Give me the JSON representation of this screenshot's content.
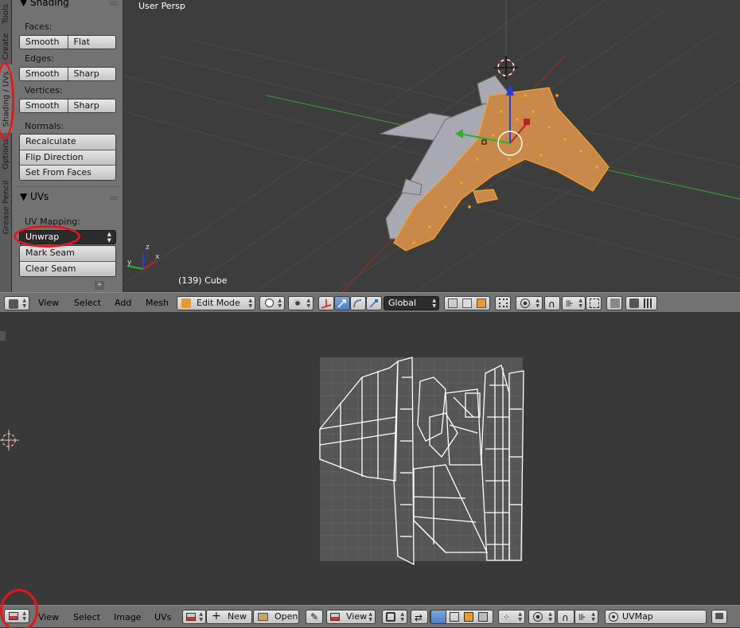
{
  "viewport3d": {
    "view_name": "User Persp",
    "object_info": "(139) Cube",
    "axis_labels": {
      "x": "x",
      "y": "y",
      "z": "z"
    }
  },
  "tabs": [
    "Tools",
    "Create",
    "Shading / UVs",
    "Options",
    "Grease Pencil"
  ],
  "shading_panel": {
    "title": "Shading",
    "faces_label": "Faces:",
    "faces_buttons": [
      "Smooth",
      "Flat"
    ],
    "edges_label": "Edges:",
    "edges_buttons": [
      "Smooth",
      "Sharp"
    ],
    "vertices_label": "Vertices:",
    "vertices_buttons": [
      "Smooth",
      "Sharp"
    ],
    "normals_label": "Normals:",
    "normals_buttons": [
      "Recalculate",
      "Flip Direction",
      "Set From Faces"
    ]
  },
  "uvs_panel": {
    "title": "UVs",
    "mapping_label": "UV Mapping:",
    "mapping_value": "Unwrap",
    "buttons": [
      "Mark Seam",
      "Clear Seam"
    ]
  },
  "header3d": {
    "menus": [
      "View",
      "Select",
      "Add",
      "Mesh"
    ],
    "mode": "Edit Mode",
    "orientation": "Global"
  },
  "header_uv": {
    "menus": [
      "View",
      "Select",
      "Image",
      "UVs"
    ],
    "new_label": "New",
    "open_label": "Open",
    "view_label": "View",
    "uvmap_label": "UVMap"
  },
  "colors": {
    "accent_red": "#e5161a",
    "selection_orange": "#f5a623",
    "axis_x": "#c02020",
    "axis_y": "#2fae2f",
    "axis_z": "#2040e0"
  }
}
